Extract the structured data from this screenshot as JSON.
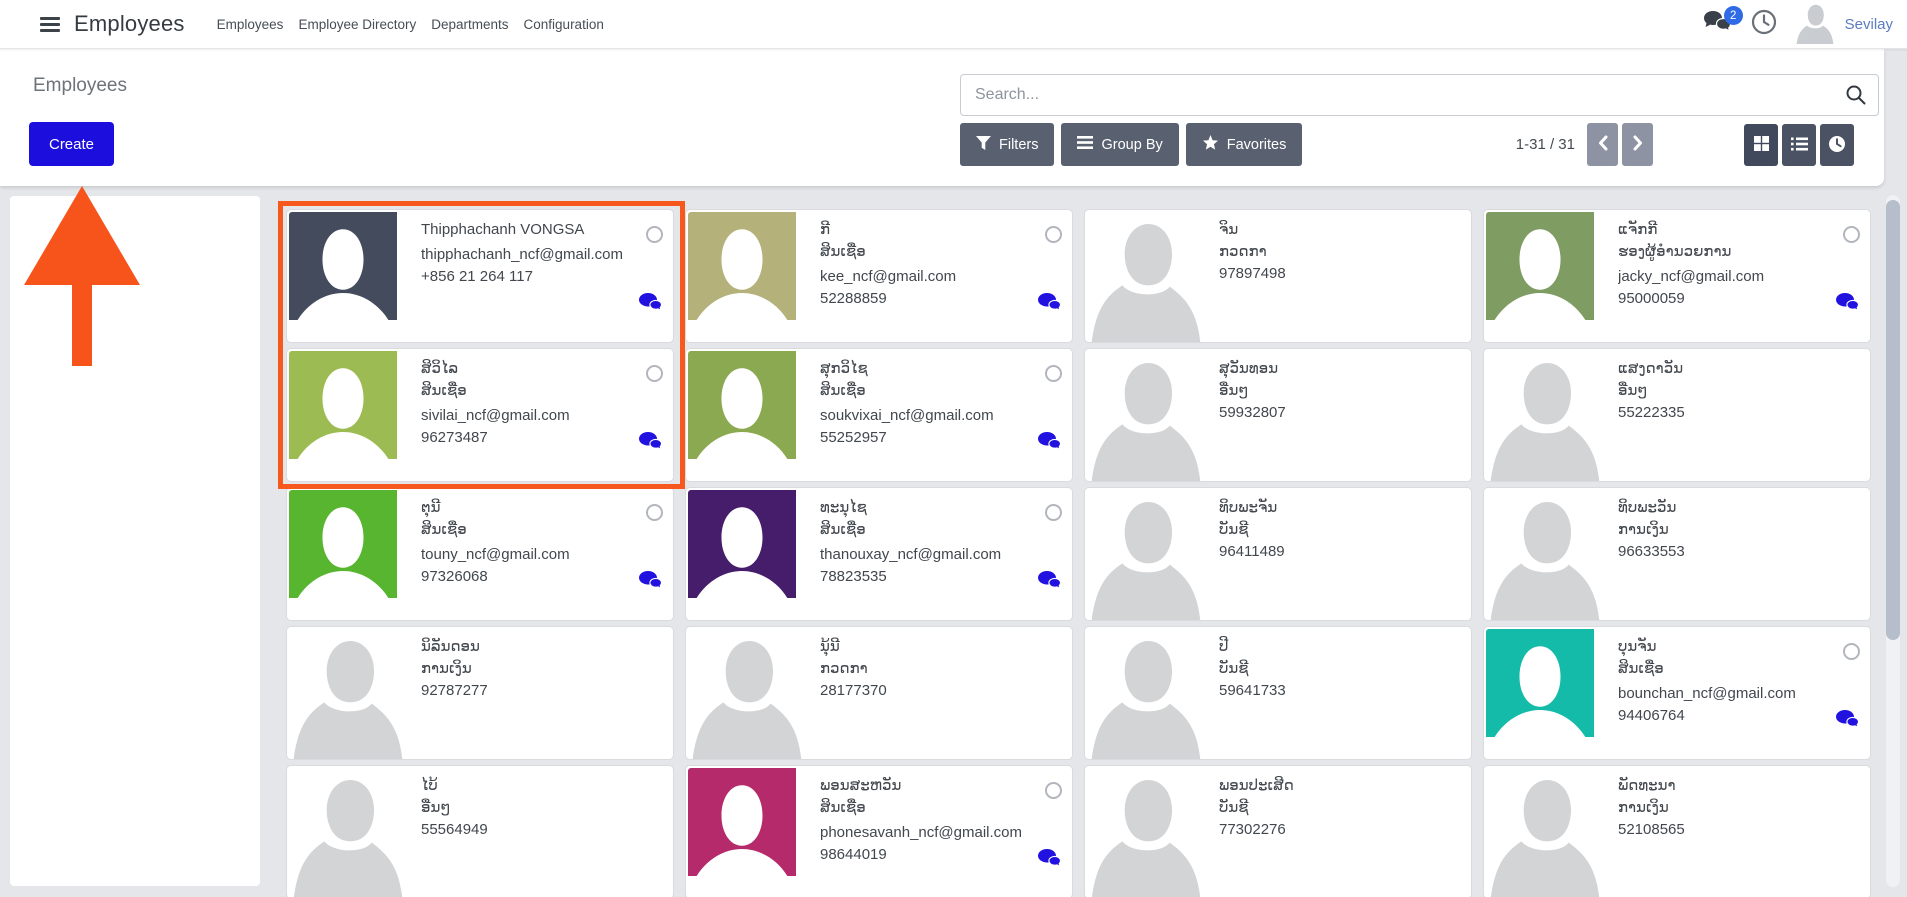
{
  "header": {
    "app_name": "Employees",
    "menu_items": [
      "Employees",
      "Employee Directory",
      "Departments",
      "Configuration"
    ],
    "messages_badge_count": "2",
    "user_name": "Sevilay"
  },
  "control_panel": {
    "breadcrumb_title": "Employees",
    "create_button_label": "Create",
    "search_placeholder": "Search...",
    "filters_label": "Filters",
    "group_by_label": "Group By",
    "favorites_label": "Favorites",
    "pager_range_text": "1-31 / 31"
  },
  "colors": {
    "create_button_blue": "#1c0edd",
    "unread_chat_blue": "#2212e0",
    "badge_blue": "#2e6be5",
    "annotation_orange": "#f6581e"
  },
  "employees": [
    {
      "name": "Thipphachanh VONGSA",
      "job_title": "",
      "email": "thipphachanh_ncf@gmail.com",
      "phone": "+856 21 264 117",
      "avatar_color": "#444b5d",
      "has_status_ring": true,
      "has_unread_message": true
    },
    {
      "name": "ກີ",
      "job_title": "ສິນເຊື່ອ",
      "email": "kee_ncf@gmail.com",
      "phone": "52288859",
      "avatar_color": "#b5b17a",
      "has_status_ring": true,
      "has_unread_message": true
    },
    {
      "name": "ຈິນ",
      "job_title": "ກວດກາ",
      "email": "",
      "phone": "97897498",
      "avatar_color": null,
      "has_status_ring": false,
      "has_unread_message": false
    },
    {
      "name": "ແຈັກກີ",
      "job_title": "ຮອງຜູ້ອຳນວຍການ",
      "email": "jacky_ncf@gmail.com",
      "phone": "95000059",
      "avatar_color": "#7f9c63",
      "has_status_ring": true,
      "has_unread_message": true
    },
    {
      "name": "ສິວິໄລ",
      "job_title": "ສິນເຊື່ອ",
      "email": "sivilai_ncf@gmail.com",
      "phone": "96273487",
      "avatar_color": "#9dbb53",
      "has_status_ring": true,
      "has_unread_message": true
    },
    {
      "name": "ສຸກວິໄຊ",
      "job_title": "ສິນເຊື່ອ",
      "email": "soukvixai_ncf@gmail.com",
      "phone": "55252957",
      "avatar_color": "#8ba950",
      "has_status_ring": true,
      "has_unread_message": true
    },
    {
      "name": "ສຸວັນທອນ",
      "job_title": "ອື່ນໆ",
      "email": "",
      "phone": "59932807",
      "avatar_color": null,
      "has_status_ring": false,
      "has_unread_message": false
    },
    {
      "name": "ແສງດາວັນ",
      "job_title": "ອື່ນໆ",
      "email": "",
      "phone": "55222335",
      "avatar_color": null,
      "has_status_ring": false,
      "has_unread_message": false
    },
    {
      "name": "ຕຸນີ",
      "job_title": "ສິນເຊື່ອ",
      "email": "touny_ncf@gmail.com",
      "phone": "97326068",
      "avatar_color": "#58b52f",
      "has_status_ring": true,
      "has_unread_message": true
    },
    {
      "name": "ທະນຸໄຊ",
      "job_title": "ສິນເຊື່ອ",
      "email": "thanouxay_ncf@gmail.com",
      "phone": "78823535",
      "avatar_color": "#451d6b",
      "has_status_ring": true,
      "has_unread_message": true
    },
    {
      "name": "ທິບພະຈັນ",
      "job_title": "ບັນຊີ",
      "email": "",
      "phone": "96411489",
      "avatar_color": null,
      "has_status_ring": false,
      "has_unread_message": false
    },
    {
      "name": "ທິບພະວັນ",
      "job_title": "ການເງິນ",
      "email": "",
      "phone": "96633553",
      "avatar_color": null,
      "has_status_ring": false,
      "has_unread_message": false
    },
    {
      "name": "ນິລັນດອນ",
      "job_title": "ການເງິນ",
      "email": "",
      "phone": "92787277",
      "avatar_color": null,
      "has_status_ring": false,
      "has_unread_message": false
    },
    {
      "name": "ນຸ້ນີ",
      "job_title": "ກວດກາ",
      "email": "",
      "phone": "28177370",
      "avatar_color": null,
      "has_status_ring": false,
      "has_unread_message": false
    },
    {
      "name": "ປີ",
      "job_title": "ບັນຊີ",
      "email": "",
      "phone": "59641733",
      "avatar_color": null,
      "has_status_ring": false,
      "has_unread_message": false
    },
    {
      "name": "ບຸນຈັນ",
      "job_title": "ສິນເຊື່ອ",
      "email": "bounchan_ncf@gmail.com",
      "phone": "94406764",
      "avatar_color": "#13bba8",
      "has_status_ring": true,
      "has_unread_message": true
    },
    {
      "name": "ໄບ້",
      "job_title": "ອື່ນໆ",
      "email": "",
      "phone": "55564949",
      "avatar_color": null,
      "has_status_ring": false,
      "has_unread_message": false
    },
    {
      "name": "ພອນສະຫວັນ",
      "job_title": "ສິນເຊື່ອ",
      "email": "phonesavanh_ncf@gmail.com",
      "phone": "98644019",
      "avatar_color": "#b52a6a",
      "has_status_ring": true,
      "has_unread_message": true
    },
    {
      "name": "ພອນປະເສີດ",
      "job_title": "ບັນຊີ",
      "email": "",
      "phone": "77302276",
      "avatar_color": null,
      "has_status_ring": false,
      "has_unread_message": false
    },
    {
      "name": "ພັດທະນາ",
      "job_title": "ການເງິນ",
      "email": "",
      "phone": "52108565",
      "avatar_color": null,
      "has_status_ring": false,
      "has_unread_message": false
    }
  ]
}
